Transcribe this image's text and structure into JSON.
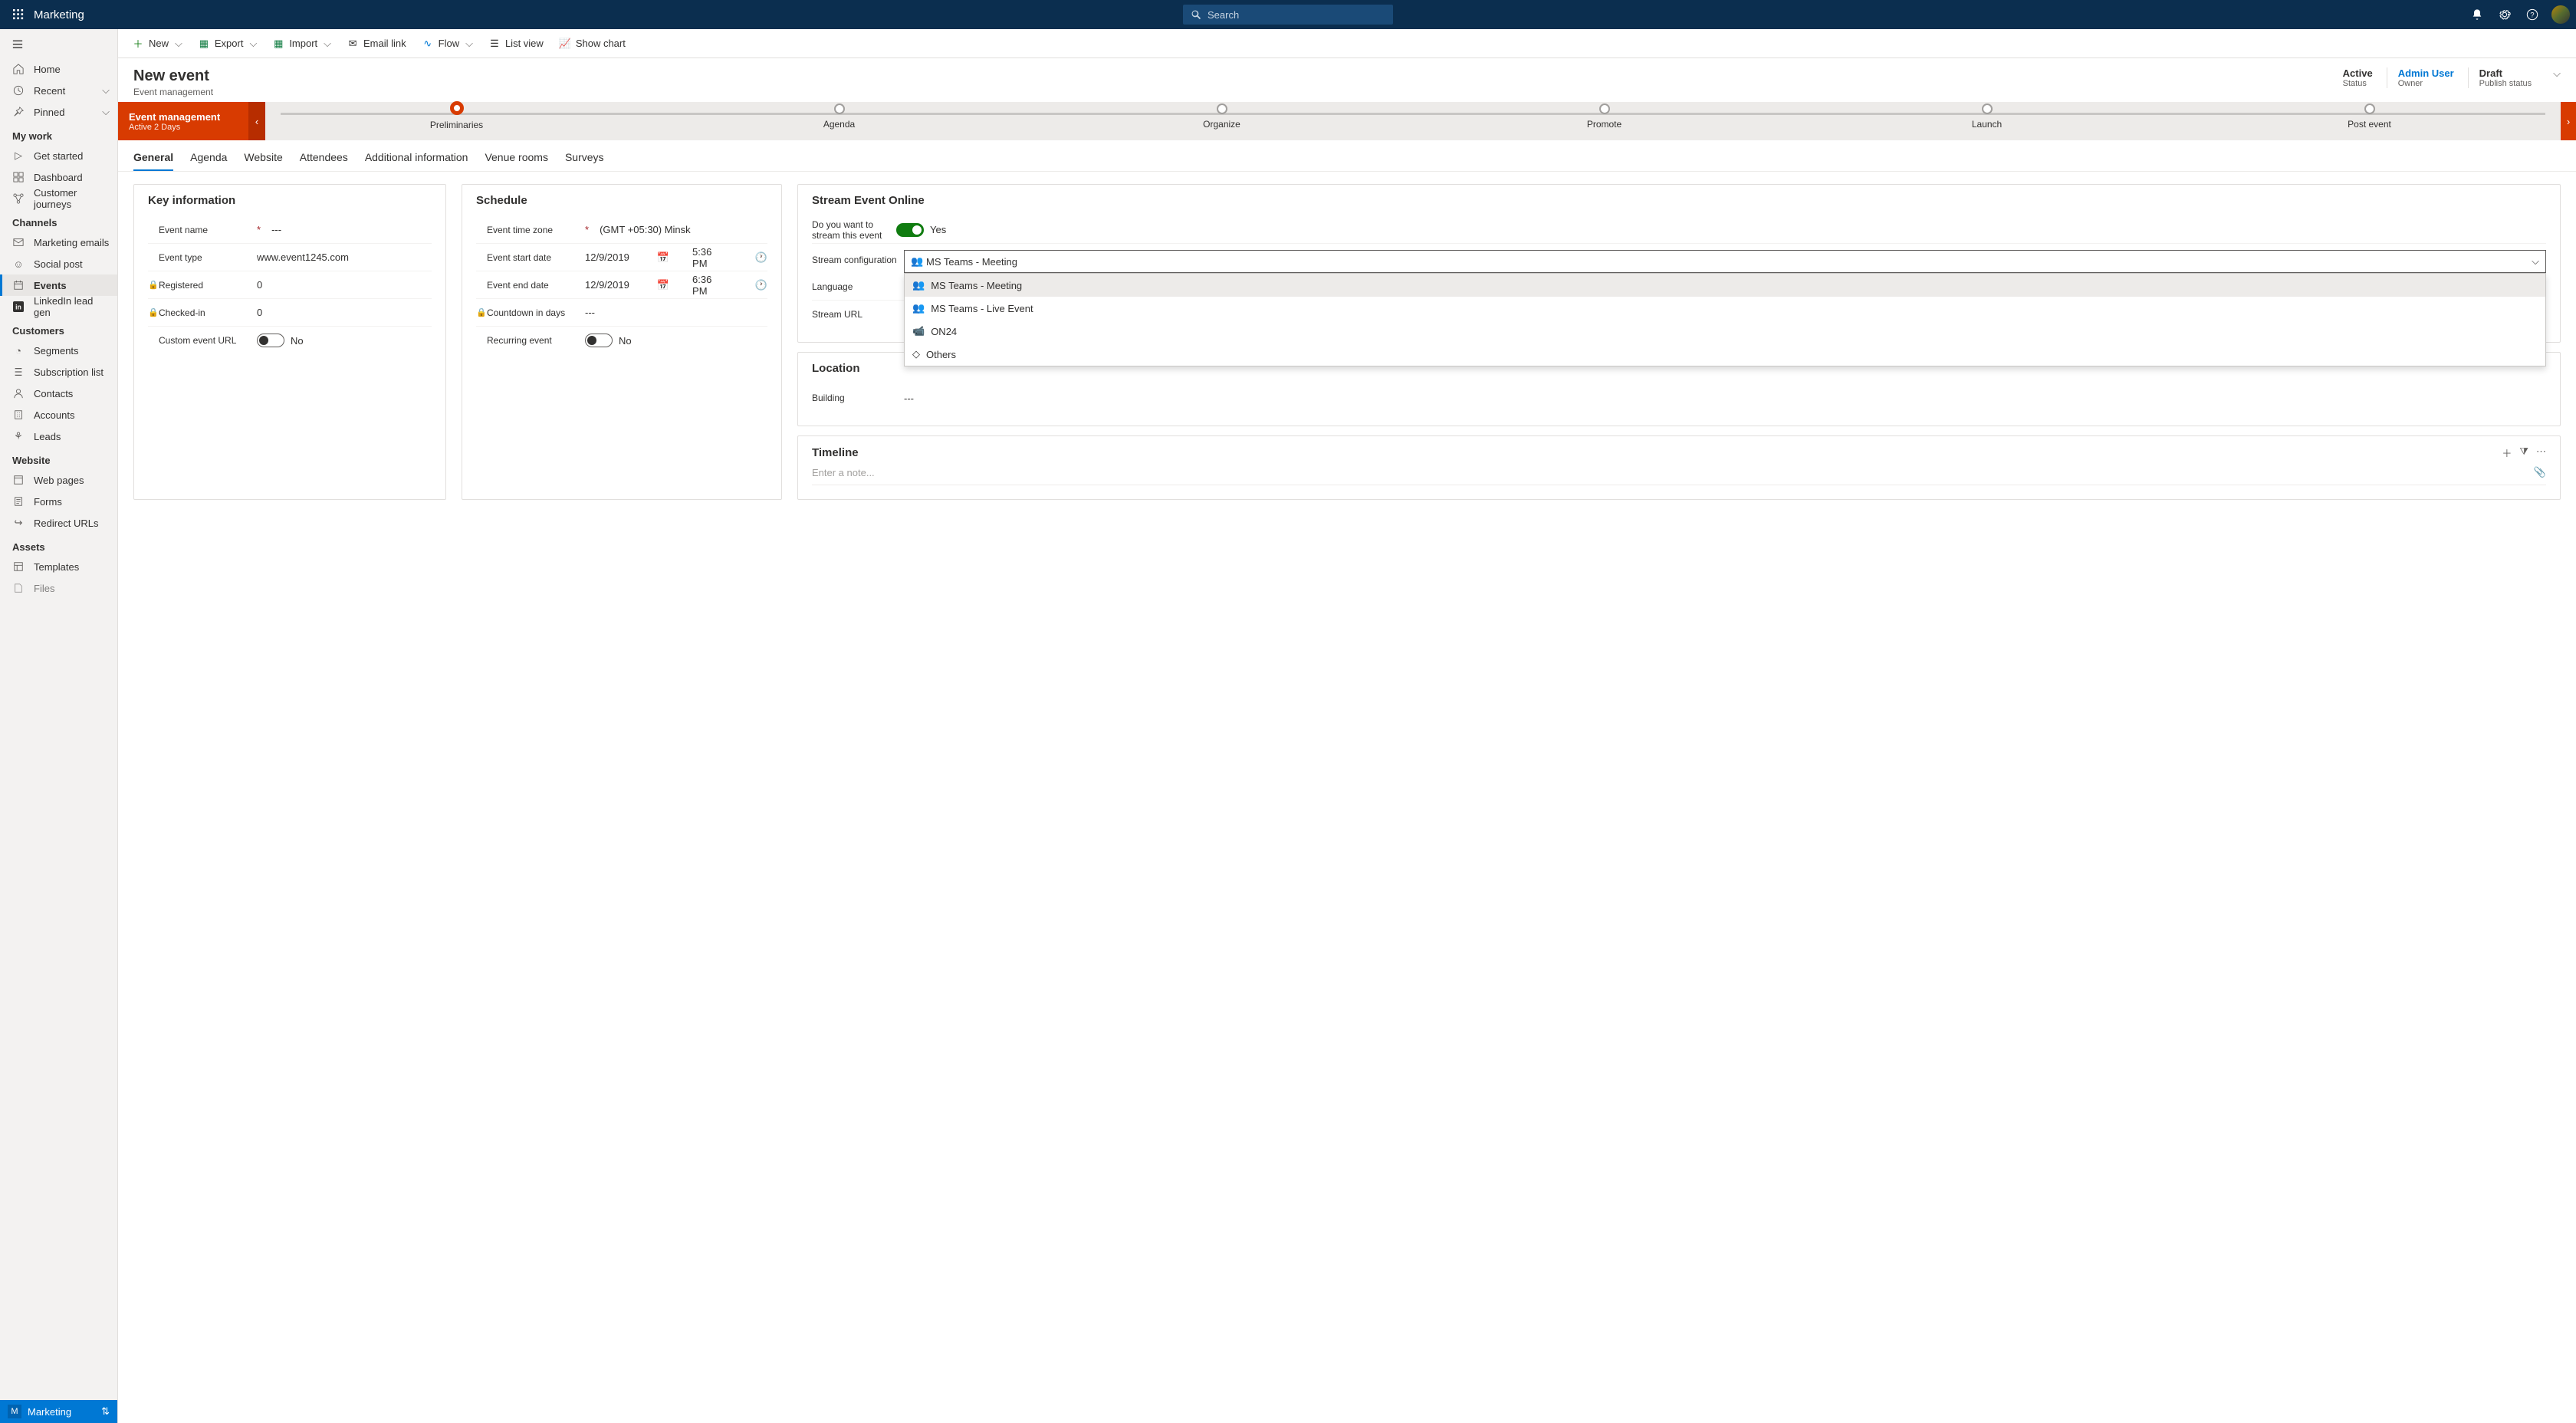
{
  "app": {
    "title": "Marketing",
    "search_placeholder": "Search"
  },
  "sidebar": {
    "home": "Home",
    "recent": "Recent",
    "pinned": "Pinned",
    "mywork_head": "My work",
    "mywork": [
      "Get started",
      "Dashboard",
      "Customer journeys"
    ],
    "channels_head": "Channels",
    "channels": [
      "Marketing emails",
      "Social post",
      "Events",
      "LinkedIn lead gen"
    ],
    "customers_head": "Customers",
    "customers": [
      "Segments",
      "Subscription list",
      "Contacts",
      "Accounts",
      "Leads"
    ],
    "website_head": "Website",
    "website": [
      "Web pages",
      "Forms",
      "Redirect URLs"
    ],
    "assets_head": "Assets",
    "assets": [
      "Templates",
      "Files"
    ],
    "footer": "Marketing",
    "footer_letter": "M"
  },
  "cmdbar": {
    "new": "New",
    "export": "Export",
    "import": "Import",
    "emaillink": "Email link",
    "flow": "Flow",
    "listview": "List view",
    "showchart": "Show chart"
  },
  "header": {
    "title": "New event",
    "subtitle": "Event management",
    "stats": [
      {
        "val": "Active",
        "lbl": "Status"
      },
      {
        "val": "Admin User",
        "lbl": "Owner",
        "link": true
      },
      {
        "val": "Draft",
        "lbl": "Publish status"
      }
    ]
  },
  "bpf": {
    "active_stage": "Event management",
    "active_time": "Active 2 Days",
    "stages": [
      "Preliminaries",
      "Agenda",
      "Organize",
      "Promote",
      "Launch",
      "Post event"
    ]
  },
  "tabs": [
    "General",
    "Agenda",
    "Website",
    "Attendees",
    "Additional information",
    "Venue rooms",
    "Surveys"
  ],
  "key": {
    "title": "Key information",
    "event_name_lbl": "Event name",
    "event_name_val": "---",
    "event_type_lbl": "Event type",
    "event_type_val": "www.event1245.com",
    "registered_lbl": "Registered",
    "registered_val": "0",
    "checkedin_lbl": "Checked-in",
    "checkedin_val": "0",
    "custom_url_lbl": "Custom event URL",
    "custom_url_val": "No"
  },
  "schedule": {
    "title": "Schedule",
    "tz_lbl": "Event time zone",
    "tz_val": "(GMT +05:30) Minsk",
    "start_lbl": "Event start date",
    "start_date": "12/9/2019",
    "start_time": "5:36 PM",
    "end_lbl": "Event end date",
    "end_date": "12/9/2019",
    "end_time": "6:36 PM",
    "countdown_lbl": "Countdown in days",
    "countdown_val": "---",
    "recurring_lbl": "Recurring event",
    "recurring_val": "No"
  },
  "stream": {
    "title": "Stream Event Online",
    "q_lbl": "Do you want to stream this event",
    "q_val": "Yes",
    "config_lbl": "Stream configuration",
    "config_val": "MS Teams - Meeting",
    "options": [
      "MS Teams - Meeting",
      "MS Teams - Live Event",
      "ON24",
      "Others"
    ],
    "lang_lbl": "Language",
    "url_lbl": "Stream URL"
  },
  "location": {
    "title": "Location",
    "building_lbl": "Building",
    "building_val": "---"
  },
  "timeline": {
    "title": "Timeline",
    "placeholder": "Enter a note..."
  }
}
